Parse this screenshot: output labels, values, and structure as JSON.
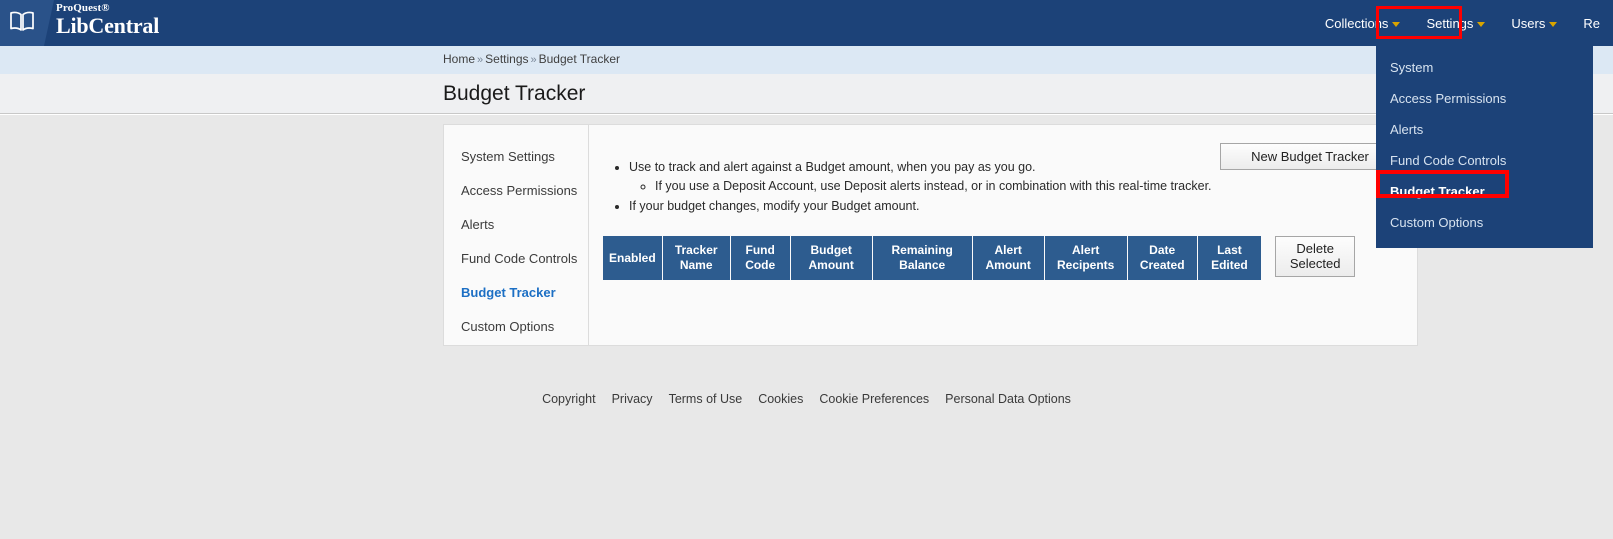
{
  "header": {
    "logo_icon": "open-book-icon",
    "brand_superscript": "ProQuest®",
    "brand_name": "LibCentral",
    "nav": [
      {
        "label": "Collections",
        "has_caret": true
      },
      {
        "label": "Settings",
        "has_caret": true,
        "highlighted": true
      },
      {
        "label": "Users",
        "has_caret": true
      },
      {
        "label": "Re",
        "has_caret": false
      }
    ]
  },
  "dropdown": {
    "open_for": "Settings",
    "items": [
      {
        "label": "System",
        "active": false
      },
      {
        "label": "Access Permissions",
        "active": false
      },
      {
        "label": "Alerts",
        "active": false
      },
      {
        "label": "Fund Code Controls",
        "active": false
      },
      {
        "label": "Budget Tracker",
        "active": true,
        "highlighted": true
      },
      {
        "label": "Custom Options",
        "active": false
      }
    ]
  },
  "breadcrumb": {
    "separator": "»",
    "items": [
      "Home",
      "Settings",
      "Budget Tracker"
    ]
  },
  "page": {
    "title": "Budget Tracker"
  },
  "sidebar": {
    "items": [
      {
        "label": "System Settings",
        "active": false
      },
      {
        "label": "Access Permissions",
        "active": false
      },
      {
        "label": "Alerts",
        "active": false
      },
      {
        "label": "Fund Code Controls",
        "active": false
      },
      {
        "label": "Budget Tracker",
        "active": true
      },
      {
        "label": "Custom Options",
        "active": false
      }
    ]
  },
  "main": {
    "new_button_label": "New Budget Tracker",
    "delete_button_label": "Delete Selected",
    "info": {
      "bullet1": "Use to track and alert against a Budget amount, when you pay as you go.",
      "sub_bullet1": "If you use a Deposit Account, use Deposit alerts instead, or in combination with this real-time tracker.",
      "bullet2": "If your budget changes, modify your Budget amount."
    },
    "table": {
      "columns": [
        {
          "line1": "Enabled",
          "line2": ""
        },
        {
          "line1": "Tracker",
          "line2": "Name"
        },
        {
          "line1": "Fund",
          "line2": "Code"
        },
        {
          "line1": "Budget",
          "line2": "Amount"
        },
        {
          "line1": "Remaining",
          "line2": "Balance"
        },
        {
          "line1": "Alert",
          "line2": "Amount"
        },
        {
          "line1": "Alert",
          "line2": "Recipents"
        },
        {
          "line1": "Date",
          "line2": "Created"
        },
        {
          "line1": "Last",
          "line2": "Edited"
        }
      ],
      "rows": []
    }
  },
  "footer": {
    "links": [
      "Copyright",
      "Privacy",
      "Terms of Use",
      "Cookies",
      "Cookie Preferences",
      "Personal Data Options"
    ]
  },
  "colors": {
    "header_navy": "#1c4278",
    "logo_navy": "#2a5289",
    "breadcrumb_band": "#dce8f4",
    "title_band": "#eff0f2",
    "body_gray": "#e8e8e8",
    "table_header": "#2d5c8f",
    "active_link": "#1c6fc4",
    "highlight_red": "#ff0000",
    "caret_gold": "#d8a400"
  }
}
